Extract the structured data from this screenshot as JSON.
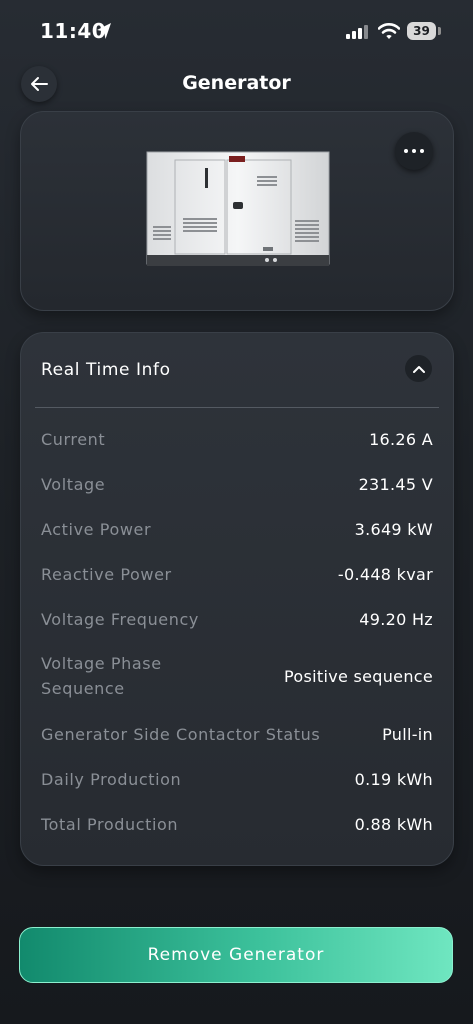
{
  "status_bar": {
    "time": "11:40",
    "battery": "39"
  },
  "header": {
    "title": "Generator"
  },
  "real_time_info": {
    "title": "Real Time Info",
    "rows": [
      {
        "label": "Current",
        "value": "16.26 A"
      },
      {
        "label": "Voltage",
        "value": "231.45 V"
      },
      {
        "label": "Active Power",
        "value": "3.649 kW"
      },
      {
        "label": "Reactive Power",
        "value": "-0.448 kvar"
      },
      {
        "label": "Voltage Frequency",
        "value": "49.20 Hz"
      },
      {
        "label": "Voltage Phase Sequence",
        "value": "Positive sequence"
      },
      {
        "label": "Generator Side Contactor Status",
        "value": "Pull-in"
      },
      {
        "label": "Daily Production",
        "value": "0.19 kWh"
      },
      {
        "label": "Total Production",
        "value": "0.88 kWh"
      }
    ]
  },
  "actions": {
    "remove_label": "Remove Generator"
  },
  "colors": {
    "accent_start": "#128a6d",
    "accent_end": "#6fe6c0",
    "label_gray": "#8a8f96"
  },
  "icons": {
    "back": "arrow-left-icon",
    "more": "ellipsis-icon",
    "collapse": "chevron-up-icon",
    "location": "location-arrow-icon",
    "signal": "cellular-signal-icon",
    "wifi": "wifi-icon"
  }
}
